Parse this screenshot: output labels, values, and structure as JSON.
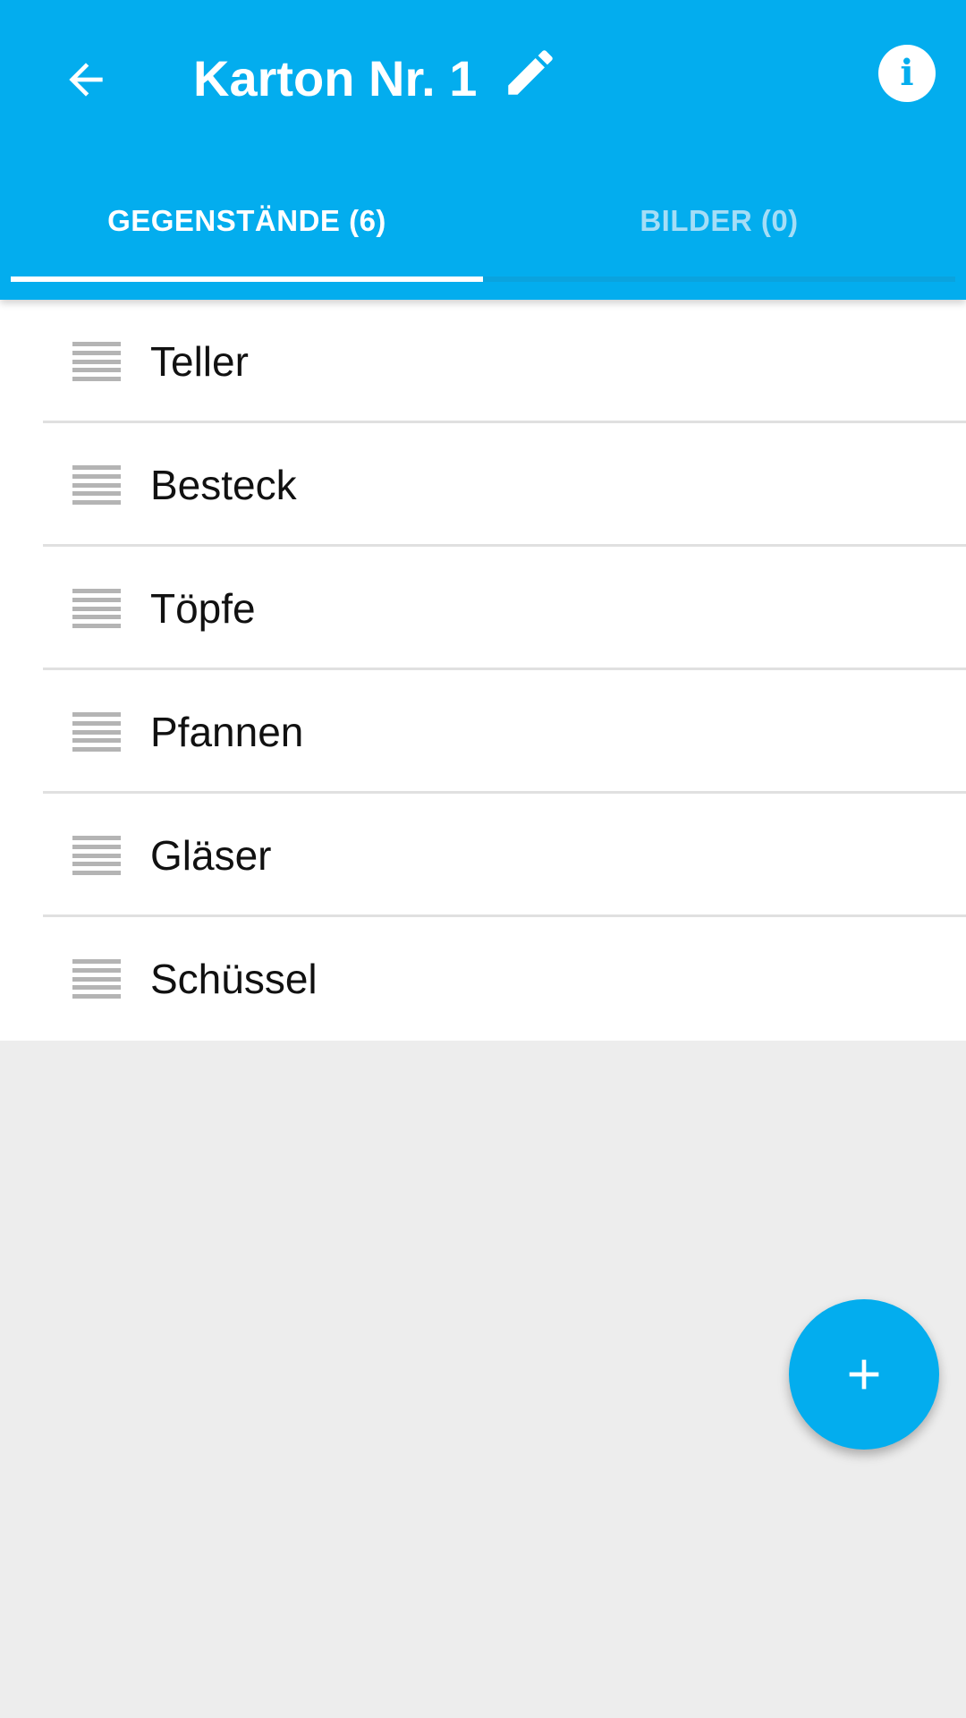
{
  "header": {
    "title": "Karton Nr. 1",
    "back_icon": "arrow-left-icon",
    "edit_icon": "pencil-icon",
    "info_icon": "info-icon",
    "info_glyph": "i",
    "background_color": "#03adee"
  },
  "tabs": [
    {
      "label": "GEGENSTÄNDE (6)",
      "active": true
    },
    {
      "label": "BILDER (0)",
      "active": false
    }
  ],
  "items": [
    {
      "label": "Teller"
    },
    {
      "label": "Besteck"
    },
    {
      "label": "Töpfe"
    },
    {
      "label": "Pfannen"
    },
    {
      "label": "Gläser"
    },
    {
      "label": "Schüssel"
    }
  ],
  "fab": {
    "icon": "plus-icon"
  }
}
